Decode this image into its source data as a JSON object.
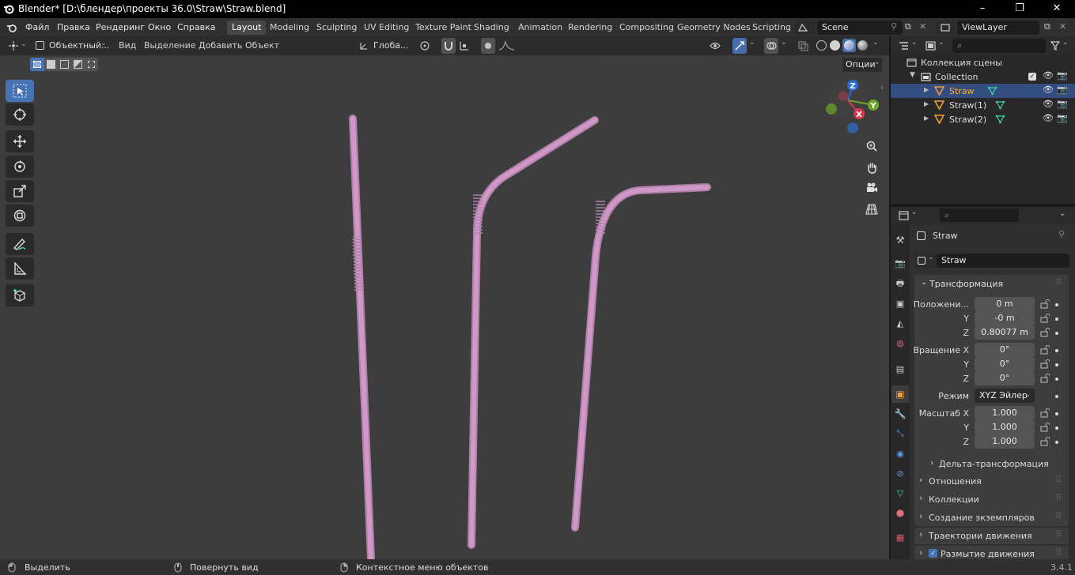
{
  "window": {
    "title": "Blender* [D:\\блендер\\проекты 36.0\\Straw\\Straw.blend]",
    "controls": [
      "–",
      "❐",
      "✕"
    ]
  },
  "menu": {
    "items": [
      "Файл",
      "Правка",
      "Рендеринг",
      "Окно",
      "Справка"
    ],
    "workspaces": [
      "Layout",
      "Modeling",
      "Sculpting",
      "UV Editing",
      "Texture Paint",
      "Shading",
      "Animation",
      "Rendering",
      "Compositing",
      "Geometry Nodes",
      "Scripting"
    ],
    "active_workspace": "Layout",
    "scene": "Scene",
    "view_layer": "ViewLayer"
  },
  "viewport": {
    "mode": "Объектный...",
    "menus": [
      "Вид",
      "Выделение",
      "Добавить",
      "Объект"
    ],
    "orientation": "Глоба...",
    "options_label": "Опции",
    "gizmo_axes": [
      "Z",
      "Y",
      "X"
    ],
    "background_color": "#3d3d3d",
    "straw_color": "#c78fbf"
  },
  "tools": [
    "select-box",
    "cursor",
    "move",
    "rotate",
    "scale",
    "transform",
    "annotate",
    "measure",
    "add-cube"
  ],
  "outliner": {
    "root": "Коллекция сцены",
    "collection": "Collection",
    "objects": [
      {
        "name": "Straw",
        "selected": true
      },
      {
        "name": "Straw(1)",
        "selected": false
      },
      {
        "name": "Straw(2)",
        "selected": false
      }
    ]
  },
  "properties": {
    "object_name_header": "Straw",
    "object_name_field": "Straw",
    "transform_panel": "Трансформация",
    "location": {
      "label": "Положени...",
      "x": "0 m",
      "y": "-0 m",
      "z": "0.80077 m"
    },
    "rotation": {
      "label": "Вращение X",
      "x": "0°",
      "y": "0°",
      "z": "0°"
    },
    "mode_label": "Режим",
    "mode_value": "XYZ Эйлер",
    "scale": {
      "label": "Масштаб X",
      "x": "1.000",
      "y": "1.000",
      "z": "1.000"
    },
    "axis_y": "Y",
    "axis_z": "Z",
    "delta_transform": "Дельта-трансформация",
    "panels": [
      "Отношения",
      "Коллекции",
      "Создание экземпляров",
      "Траектории движения",
      "Размытие движения"
    ]
  },
  "statusbar": {
    "select": "Выделить",
    "rotate_view": "Повернуть вид",
    "context_menu": "Контекстное меню объектов",
    "version": "3.4.1"
  }
}
